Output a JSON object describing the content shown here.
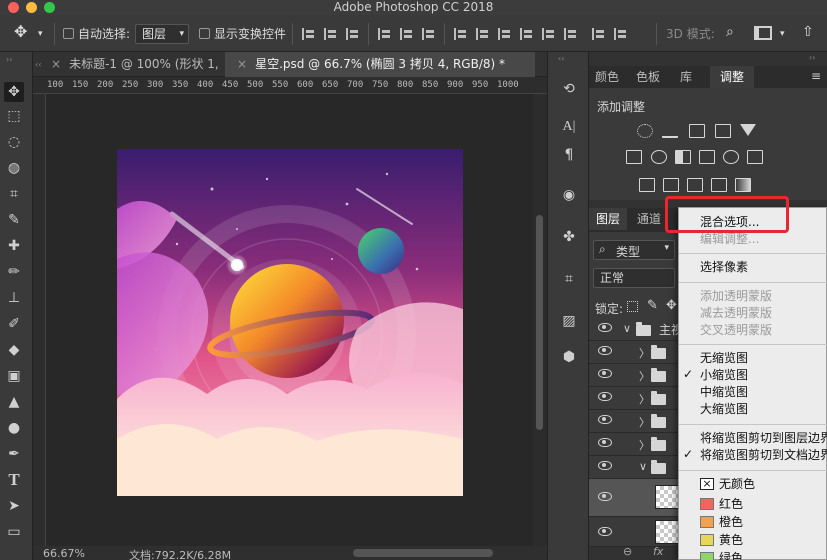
{
  "window": {
    "title": "Adobe Photoshop CC 2018",
    "traffic_colors": [
      "#fc605b",
      "#fdbc40",
      "#34c84a"
    ]
  },
  "options_bar": {
    "move_icon": "move-tool-icon",
    "auto_select_label": "自动选择:",
    "auto_select_value": "图层",
    "show_transform_label": "显示变换控件",
    "mode_3d_label": "3D 模式:"
  },
  "tabs": [
    {
      "label": "未标题-1 @ 100% (形状 1, ...",
      "close": "×"
    },
    {
      "label": "星空.psd @ 66.7% (椭圆 3 拷贝 4, RGB/8) *",
      "close": "×"
    }
  ],
  "ruler_ticks": [
    "100",
    "150",
    "200",
    "250",
    "300",
    "350",
    "400",
    "450",
    "500",
    "550",
    "600",
    "650",
    "700",
    "750",
    "800",
    "850",
    "900",
    "950",
    "1000"
  ],
  "status": {
    "zoom": "66.67%",
    "doc": "文档:792.2K/6.28M"
  },
  "adjustments_panel": {
    "tabs": [
      "颜色",
      "色板",
      "库",
      "调整"
    ],
    "active_tab": "调整",
    "heading": "添加调整"
  },
  "layers_panel": {
    "tabs": [
      "图层",
      "通道"
    ],
    "filter_label": "类型",
    "blend_mode": "正常",
    "lock_label": "锁定:",
    "group_name": "主视"
  },
  "context_menu": {
    "items": [
      {
        "label": "混合选项...",
        "disabled": false,
        "checked": false
      },
      {
        "label": "编辑调整...",
        "disabled": true,
        "checked": false
      },
      {
        "label": "选择像素",
        "disabled": false,
        "checked": false
      },
      {
        "label": "添加透明蒙版",
        "disabled": true,
        "checked": false
      },
      {
        "label": "减去透明蒙版",
        "disabled": true,
        "checked": false
      },
      {
        "label": "交叉透明蒙版",
        "disabled": true,
        "checked": false
      },
      {
        "label": "无缩览图",
        "disabled": false,
        "checked": false
      },
      {
        "label": "小缩览图",
        "disabled": false,
        "checked": true
      },
      {
        "label": "中缩览图",
        "disabled": false,
        "checked": false
      },
      {
        "label": "大缩览图",
        "disabled": false,
        "checked": false
      },
      {
        "label": "将缩览图剪切到图层边界",
        "disabled": false,
        "checked": false
      },
      {
        "label": "将缩览图剪切到文档边界",
        "disabled": false,
        "checked": true
      },
      {
        "label": "无颜色",
        "disabled": false,
        "checked": false
      },
      {
        "label": "红色",
        "disabled": false,
        "checked": false
      },
      {
        "label": "橙色",
        "disabled": false,
        "checked": false
      },
      {
        "label": "黄色",
        "disabled": false,
        "checked": false
      },
      {
        "label": "绿色",
        "disabled": false,
        "checked": false
      }
    ],
    "swatch_colors": [
      "#ffffff",
      "#f2645c",
      "#f5a04a",
      "#e6d75b",
      "#8fd36b"
    ],
    "no_color_mark": "×",
    "check_mark": "✓"
  },
  "highlight_color": "#e8282e"
}
